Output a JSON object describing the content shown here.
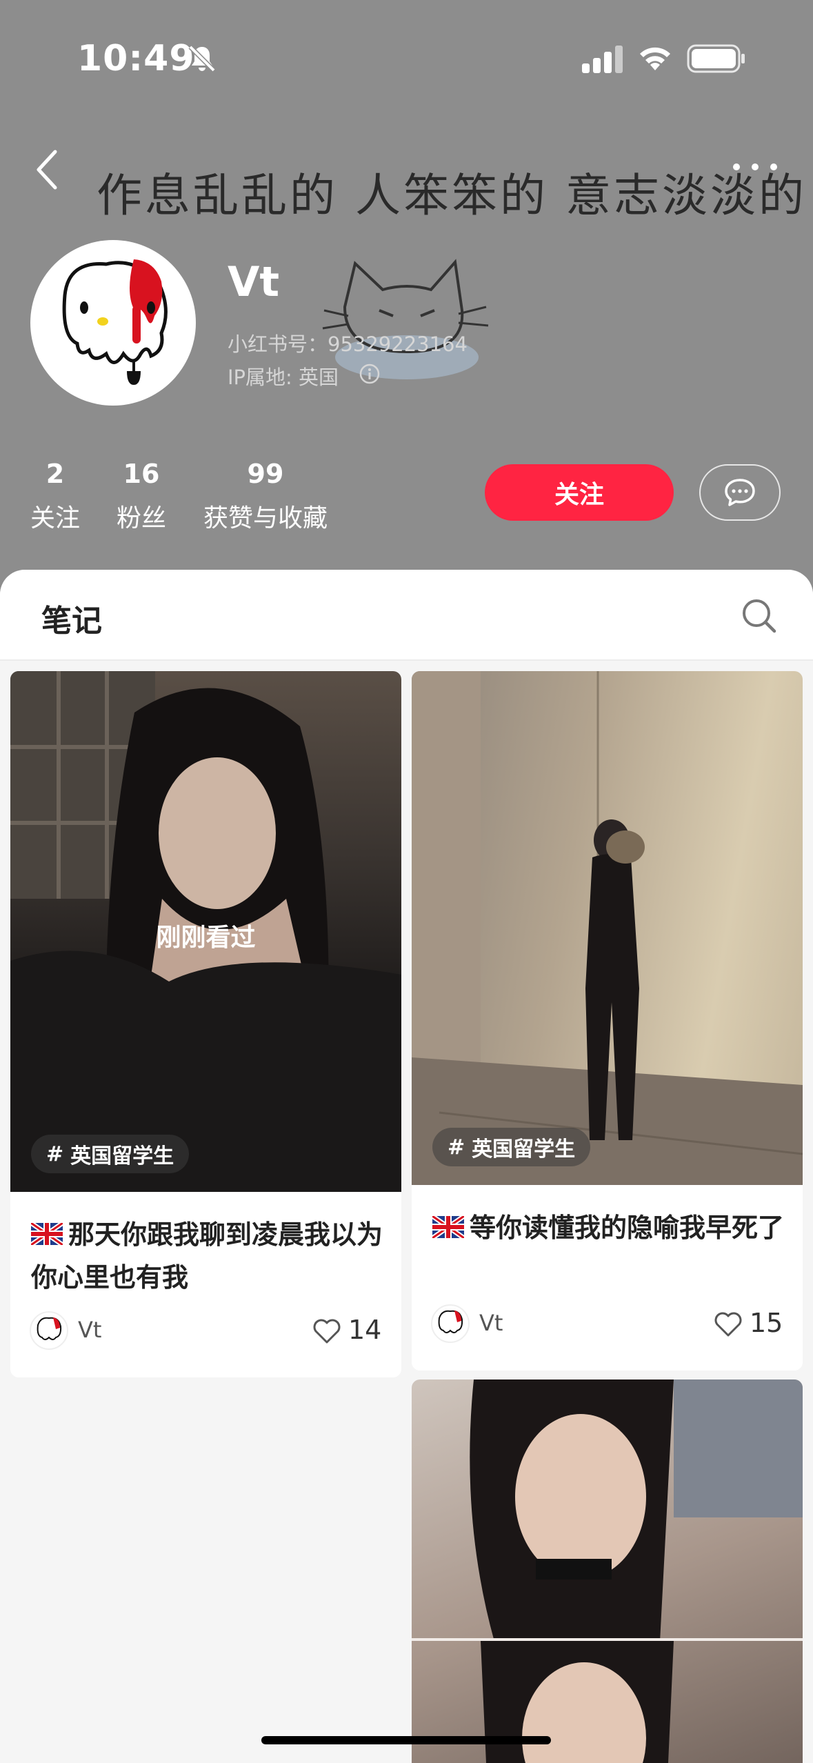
{
  "status_bar": {
    "time": "10:49",
    "icons": [
      "bell-muted-icon",
      "signal-icon",
      "wifi-icon",
      "battery-icon"
    ]
  },
  "nav": {
    "back_icon": "chevron-left-icon",
    "more_icon": "more-dots-icon"
  },
  "banner": {
    "text": "作息乱乱的 人笨笨的 意志淡淡的"
  },
  "profile": {
    "name": "Vt",
    "id_label": "小红书号：9532922316​4",
    "ip_label": "IP属地: 英国",
    "avatar": "melting-cat-avatar"
  },
  "stats": [
    {
      "value": "2",
      "label": "关注"
    },
    {
      "value": "16",
      "label": "粉丝"
    },
    {
      "value": "99",
      "label": "获赞与收藏"
    }
  ],
  "actions": {
    "follow_label": "关注",
    "message_icon": "chat-bubble-icon"
  },
  "tabs": {
    "notes_label": "笔记",
    "search_icon": "search-icon"
  },
  "notes": [
    {
      "overlay": "刚刚看过",
      "tag": "英国留学生",
      "title": "那天你跟我聊到凌晨我以为你心里也有我",
      "author": "Vt",
      "likes": "14"
    },
    {
      "tag": "英国留学生",
      "title": "等你读懂我的隐喻我早死了",
      "author": "Vt",
      "likes": "15"
    }
  ],
  "colors": {
    "header_bg": "#8d8d8d",
    "accent": "#ff2442"
  }
}
